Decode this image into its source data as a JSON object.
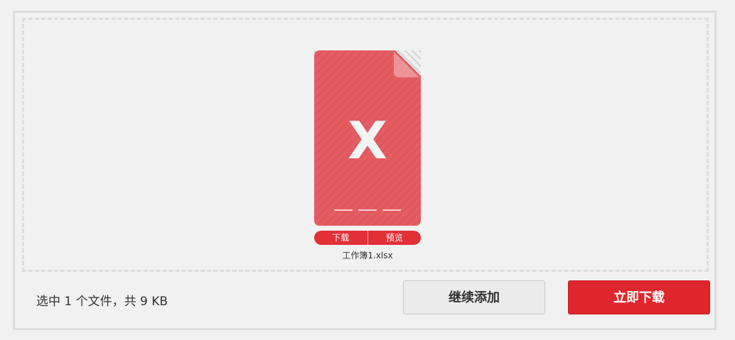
{
  "file": {
    "icon": "xlsx-file-icon",
    "icon_letter": "X",
    "name": "工作簿1.xlsx",
    "actions": {
      "download_label": "下载",
      "preview_label": "预览"
    }
  },
  "status": {
    "text": "选中 1 个文件，共 9 KB"
  },
  "buttons": {
    "continue_label": "继续添加",
    "download_now_label": "立即下载"
  },
  "colors": {
    "accent": "#e0262d",
    "file_icon": "#e35d62",
    "background": "#f1f1f1"
  }
}
